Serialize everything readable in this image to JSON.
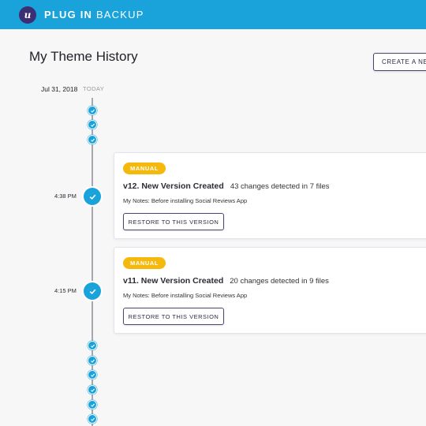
{
  "header": {
    "logo_letter": "u",
    "brand_bold": "PLUG IN",
    "brand_light": "BACKUP",
    "bg_color": "#1aa3db",
    "logo_color": "#3b2e73"
  },
  "page": {
    "title": "My Theme History",
    "create_button": "CREATE A NEW"
  },
  "timeline": {
    "date": "Jul 31, 2018",
    "today_label": "TODAY",
    "accent_color": "#1aa3db",
    "entries": [
      {
        "time": "4:38 PM",
        "badge": "MANUAL",
        "title": "v12. New Version Created",
        "changes": "43 changes detected in 7 files",
        "notes": "My Notes: Before installing Social Reviews App",
        "restore_label": "RESTORE TO THIS VERSION"
      },
      {
        "time": "4:15 PM",
        "badge": "MANUAL",
        "title": "v11. New Version Created",
        "changes": "20 changes detected in 9 files",
        "notes": "My Notes: Before installing Social Reviews App",
        "restore_label": "RESTORE TO THIS VERSION"
      }
    ]
  },
  "badge_color": "#f5b90d"
}
